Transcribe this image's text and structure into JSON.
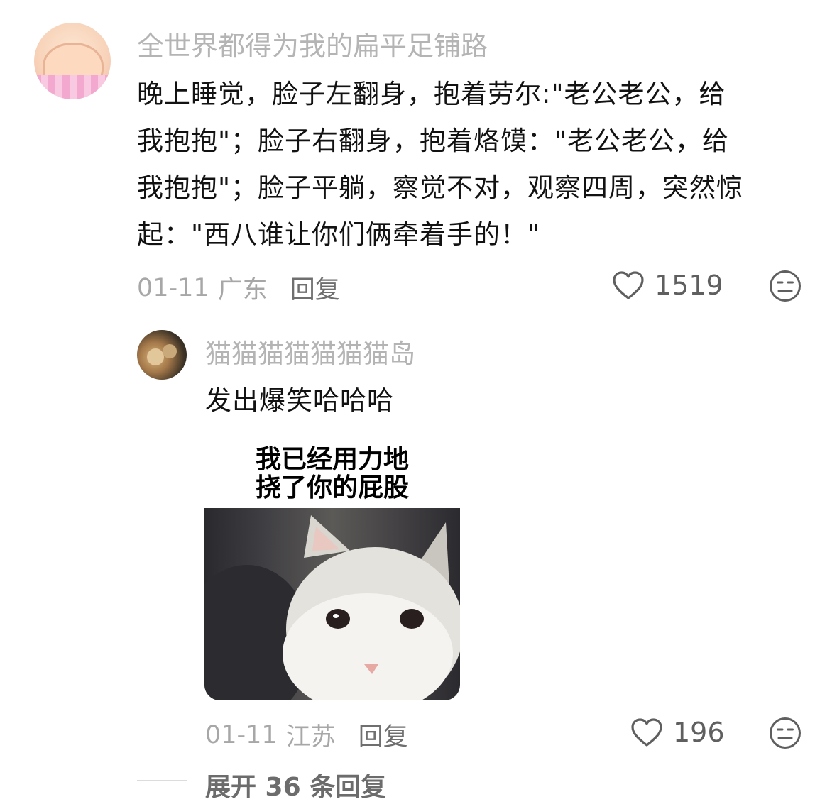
{
  "comment": {
    "username": "全世界都得为我的扁平足铺路",
    "text_lines": [
      "晚上睡觉，脸子左翻身，抱着劳尔:\"老公老公，给",
      "我抱抱\"；脸子右翻身，抱着烙馍：\"老公老公，给",
      "我抱抱\"；脸子平躺，察觉不对，观察四周，突然惊",
      "起：\"西八谁让你们俩牵着手的！\""
    ],
    "date": "01-11",
    "location": "广东",
    "reply_label": "回复",
    "likes": "1519",
    "like_icon": "heart-outline-icon",
    "dislike_icon": "meh-face-icon"
  },
  "reply": {
    "username": "猫猫猫猫猫猫猫岛",
    "text": "发出爆笑哈哈哈",
    "meme": {
      "caption_lines": [
        "我已经用力地",
        "挠了你的屁股"
      ],
      "image_subject": "white-cat-photo"
    },
    "date": "01-11",
    "location": "江苏",
    "reply_label": "回复",
    "likes": "196"
  },
  "expand_replies": "展开 36 条回复",
  "colors": {
    "username": "#b4b4b4",
    "text": "#121212",
    "meta": "#a7a7a7",
    "reply_link": "#6f6f6f",
    "icon": "#5f5f5f"
  }
}
